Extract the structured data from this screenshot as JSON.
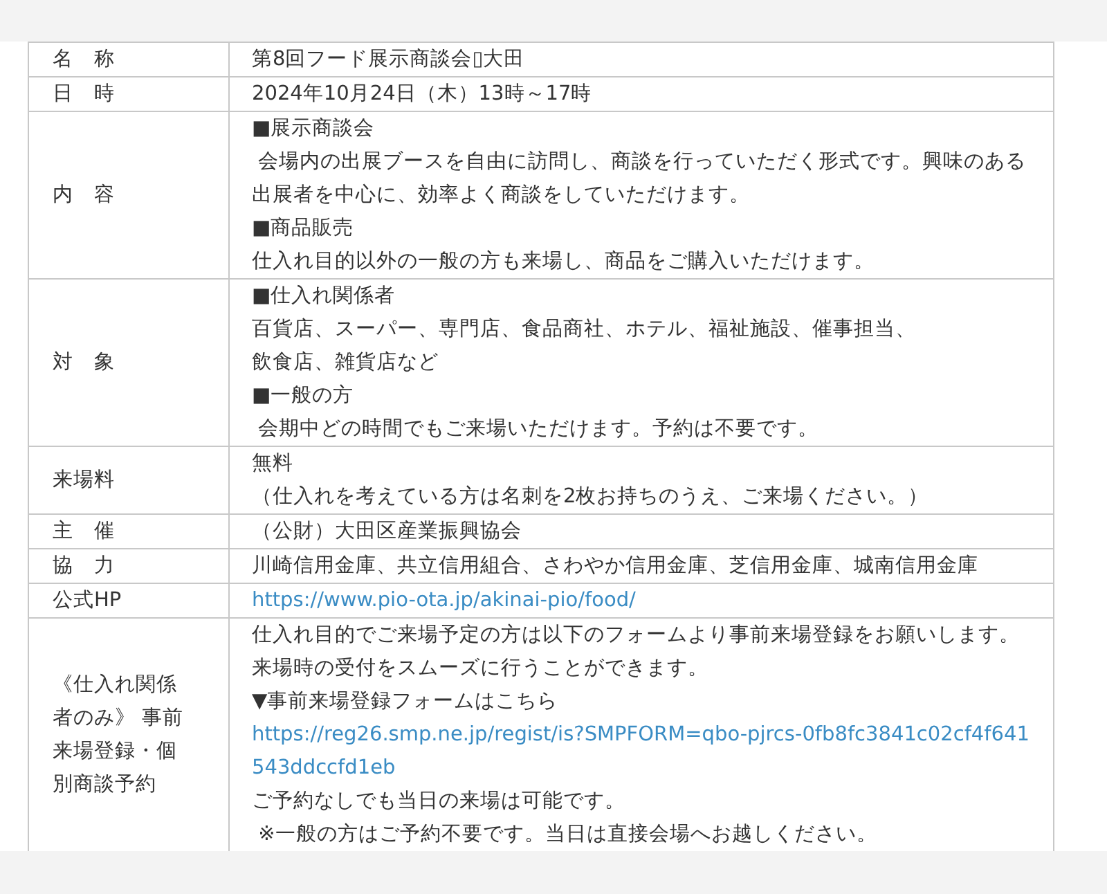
{
  "rows": [
    {
      "label": "名　称",
      "content": [
        {
          "kind": "text",
          "text": "第8回フード展示商談会▯大田"
        }
      ]
    },
    {
      "label": "日　時",
      "content": [
        {
          "kind": "text",
          "text": "2024年10月24日（木）13時～17時"
        }
      ]
    },
    {
      "label": "内　容",
      "content": [
        {
          "kind": "text",
          "text": "■展示商談会"
        },
        {
          "kind": "text",
          "text": " 会場内の出展ブースを自由に訪問し、商談を行っていただく形式です。興味のある出展者を中心に、効率よく商談をしていただけます。"
        },
        {
          "kind": "text",
          "text": "■商品販売"
        },
        {
          "kind": "text",
          "text": "仕入れ目的以外の一般の方も来場し、商品をご購入いただけます。"
        }
      ]
    },
    {
      "label": "対　象",
      "content": [
        {
          "kind": "text",
          "text": "■仕入れ関係者"
        },
        {
          "kind": "text",
          "text": "百貨店、スーパー、専門店、食品商社、ホテル、福祉施設、催事担当、"
        },
        {
          "kind": "text",
          "text": "飲食店、雑貨店など"
        },
        {
          "kind": "text",
          "text": "■一般の方"
        },
        {
          "kind": "text",
          "text": " 会期中どの時間でもご来場いただけます。予約は不要です。"
        }
      ]
    },
    {
      "label": "来場料",
      "content": [
        {
          "kind": "text",
          "text": "無料"
        },
        {
          "kind": "text",
          "text": "（仕入れを考えている方は名刺を2枚お持ちのうえ、ご来場ください。）"
        }
      ]
    },
    {
      "label": "主　催",
      "content": [
        {
          "kind": "text",
          "text": "（公財）大田区産業振興協会"
        }
      ]
    },
    {
      "label": "協　力",
      "content": [
        {
          "kind": "text",
          "text": "川崎信用金庫、共立信用組合、さわやか信用金庫、芝信用金庫、城南信用金庫"
        }
      ]
    },
    {
      "label": "公式HP",
      "content": [
        {
          "kind": "link",
          "text": "https://www.pio-ota.jp/akinai-pio/food/"
        }
      ]
    },
    {
      "label": "《仕入れ関係者のみ》 事前来場登録・個別商談予約",
      "content": [
        {
          "kind": "text",
          "text": "仕入れ目的でご来場予定の方は以下のフォームより事前来場登録をお願いします。来場時の受付をスムーズに行うことができます。"
        },
        {
          "kind": "text",
          "text": "▼事前来場登録フォームはこちら"
        },
        {
          "kind": "link",
          "text": "https://reg26.smp.ne.jp/regist/is?SMPFORM=qbo-pjrcs-0fb8fc3841c02cf4f641543ddccfd1eb"
        },
        {
          "kind": "text",
          "text": "ご予約なしでも当日の来場は可能です。"
        },
        {
          "kind": "text",
          "text": " ※一般の方はご予約不要です。当日は直接会場へお越しください。"
        }
      ]
    }
  ]
}
